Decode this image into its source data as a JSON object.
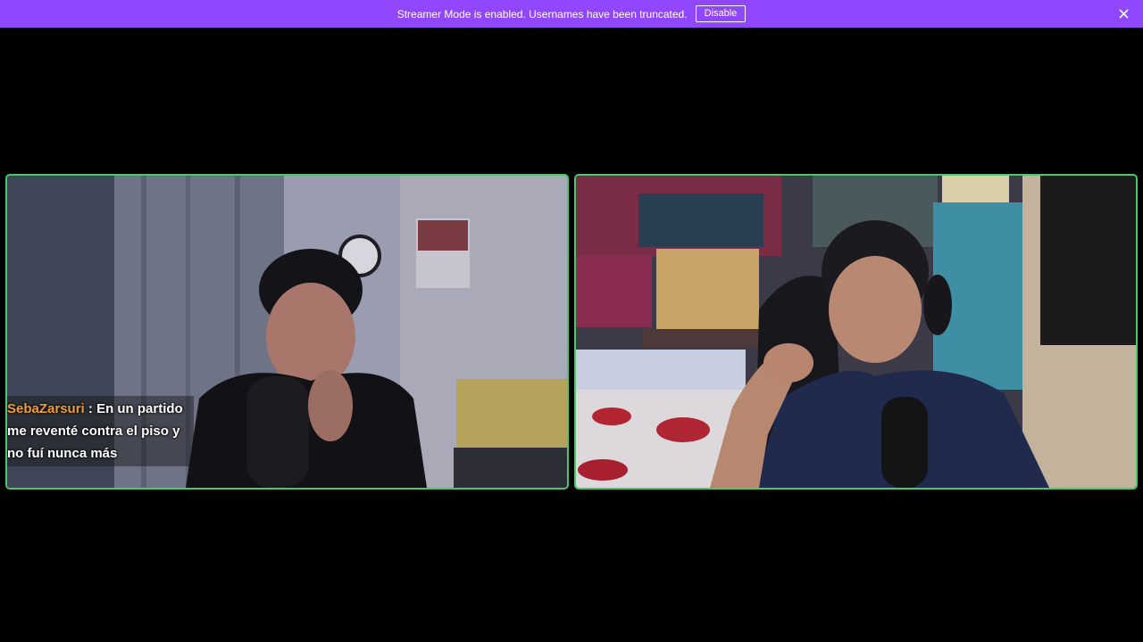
{
  "banner": {
    "message": "Streamer Mode is enabled. Usernames have been truncated.",
    "disable_label": "Disable",
    "color": "#9146ff"
  },
  "tiles": {
    "border_color": "#47c96a",
    "left": {
      "caption_user": "SebaZarsuri",
      "caption_sep": " : ",
      "caption_text": "En un partido me reventé contra el piso y no fuí nunca más"
    }
  }
}
